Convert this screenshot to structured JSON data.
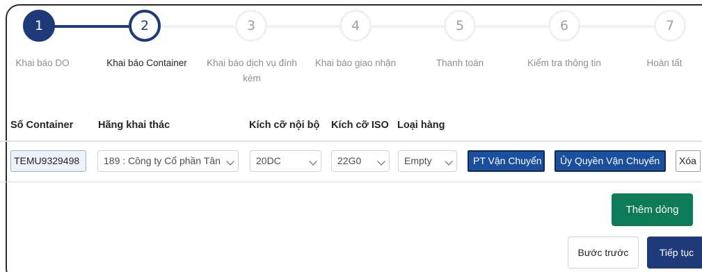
{
  "stepper": {
    "steps": [
      {
        "number": "1",
        "label": "Khai báo DO",
        "state": "complete"
      },
      {
        "number": "2",
        "label": "Khai báo Container",
        "state": "active"
      },
      {
        "number": "3",
        "label": "Khai báo dịch vụ đính",
        "label2": "kèm",
        "state": "pending"
      },
      {
        "number": "4",
        "label": "Khai báo giao nhận",
        "state": "pending"
      },
      {
        "number": "5",
        "label": "Thanh toán",
        "state": "pending"
      },
      {
        "number": "6",
        "label": "Kiểm tra thông tin",
        "state": "pending"
      },
      {
        "number": "7",
        "label": "Hoàn tất",
        "state": "pending"
      }
    ]
  },
  "table": {
    "headers": {
      "container_no": "Số Container",
      "operator": "Hãng khai thác",
      "internal_size": "Kích cỡ nội bộ",
      "iso_size": "Kích cỡ ISO",
      "cargo_type": "Loại hàng"
    },
    "rows": [
      {
        "container_no": "TEMU9329498",
        "operator": "189 : Công ty Cổ phần Tân",
        "internal_size": "20DC",
        "iso_size": "22G0",
        "cargo_type": "Empty",
        "transport_btn": "PT Vận Chuyển",
        "authorize_btn": "Ủy Quyền Vận Chuyển",
        "delete_btn": "Xóa"
      }
    ]
  },
  "actions": {
    "add_row": "Thêm dòng",
    "previous": "Bước trước",
    "next": "Tiếp tục"
  },
  "colors": {
    "primary": "#1e3a78",
    "button_blue": "#1b4f9c",
    "success": "#0d7a58"
  }
}
